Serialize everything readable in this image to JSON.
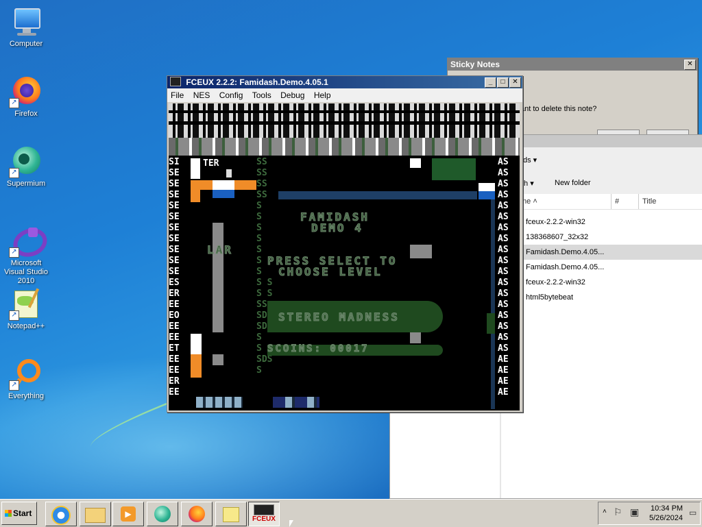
{
  "desktop": {
    "icons": [
      {
        "label": "Computer",
        "icon": "computer-icon"
      },
      {
        "label": "Firefox",
        "icon": "firefox-icon"
      },
      {
        "label": "Supermium",
        "icon": "supermium-icon"
      },
      {
        "label": "Microsoft Visual Studio 2010",
        "icon": "visual-studio-icon"
      },
      {
        "label": "Notepad++",
        "icon": "notepadpp-icon"
      },
      {
        "label": "Everything",
        "icon": "everything-icon"
      }
    ]
  },
  "sticky": {
    "title": "Sticky Notes",
    "message_fragment": "ant to delete this note?"
  },
  "explorer": {
    "breadcrumb_fragment": "ds",
    "toolbar_share_fragment": "th",
    "new_folder": "New folder",
    "columns": {
      "name": "me",
      "num": "#",
      "title": "Title"
    },
    "files": [
      "fceux-2.2.2-win32",
      "138368607_32x32",
      "Famidash.Demo.4.05...",
      "Famidash.Demo.4.05...",
      "fceux-2.2.2-win32",
      "html5bytebeat"
    ],
    "selected_index": 2
  },
  "fceux": {
    "title": "FCEUX 2.2.2: Famidash.Demo.4.05.1",
    "menu": [
      "File",
      "NES",
      "Config",
      "Tools",
      "Debug",
      "Help"
    ],
    "game": {
      "title_line1": "FAMIDASH",
      "title_line2": "DEMO 4",
      "prompt_line1": "PRESS SELECT TO",
      "prompt_line2": "CHOOSE LEVEL",
      "level_name": "STEREO MADNESS",
      "coins": "SCOINS: 00017",
      "fragment_ter": "TER",
      "fragment_lar": "LAR",
      "left_column": "SI\nSE\nSE\nSE\nSE\nSE\nSE\nSE\nSE\nSE\nSE\nES\nER\nEE\nEO\nEE\nEE\nET\nEE\nEE\nER\nEE",
      "right_column": "AS\nAS\nAS\nAS\nAS\nAS\nAS\nAS\nAS\nAS\nAS\nAS\nAS\nAS\nAS\nAS\nAS\nAS\nAE\nAE\nAE\nAE",
      "ss_column": "SS\nSS\nSS\nSS\nS\nS\nS\nS\nS\nS\nS\nS S\nS S\nSS\nSDS\nSDS\nS\nS\nSDS\nS"
    }
  },
  "taskbar": {
    "start_label": "Start",
    "fceux_label": "FCEUX",
    "time": "10:34 PM",
    "date": "5/26/2024"
  },
  "colors": {
    "selected_row": "#d9d9d9",
    "title_active": "#0a246a",
    "title_inactive": "#808080",
    "nes_green": "#1f4a1f",
    "nes_orange": "#f08c28",
    "nes_blue": "#1a60c0"
  }
}
